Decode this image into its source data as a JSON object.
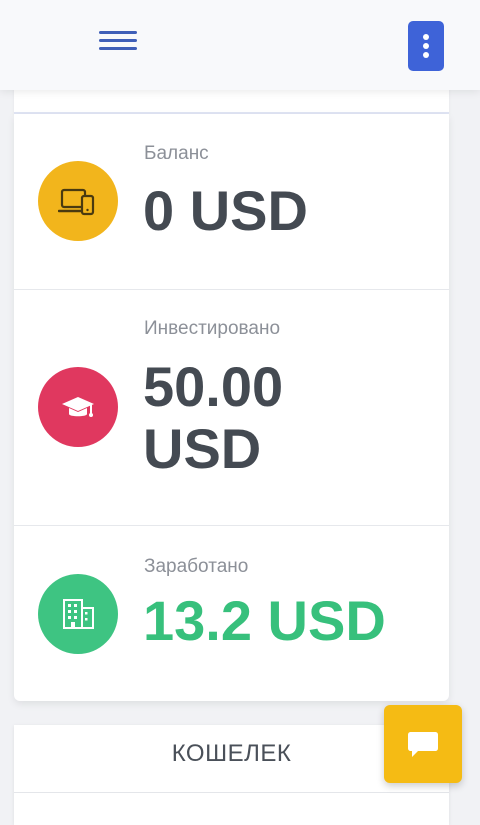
{
  "header": {
    "menu_icon": "hamburger-menu-icon",
    "more_icon": "vertical-dots-icon",
    "accent_color": "#3e63d8"
  },
  "stats": [
    {
      "label": "Баланс",
      "value": "0 USD",
      "icon": "laptop-phone-icon",
      "icon_color": "#f2b51c"
    },
    {
      "label": "Инвестировано",
      "value": "50.00 USD",
      "icon": "graduation-cap-icon",
      "icon_color": "#e0385f"
    },
    {
      "label": "Заработано",
      "value": "13.2 USD",
      "icon": "building-icon",
      "icon_color": "#3ec482",
      "value_color": "#37c07c"
    }
  ],
  "wallet": {
    "title": "КОШЕЛЕК"
  },
  "chat": {
    "icon": "chat-bubble-icon",
    "color": "#f5bb14"
  }
}
